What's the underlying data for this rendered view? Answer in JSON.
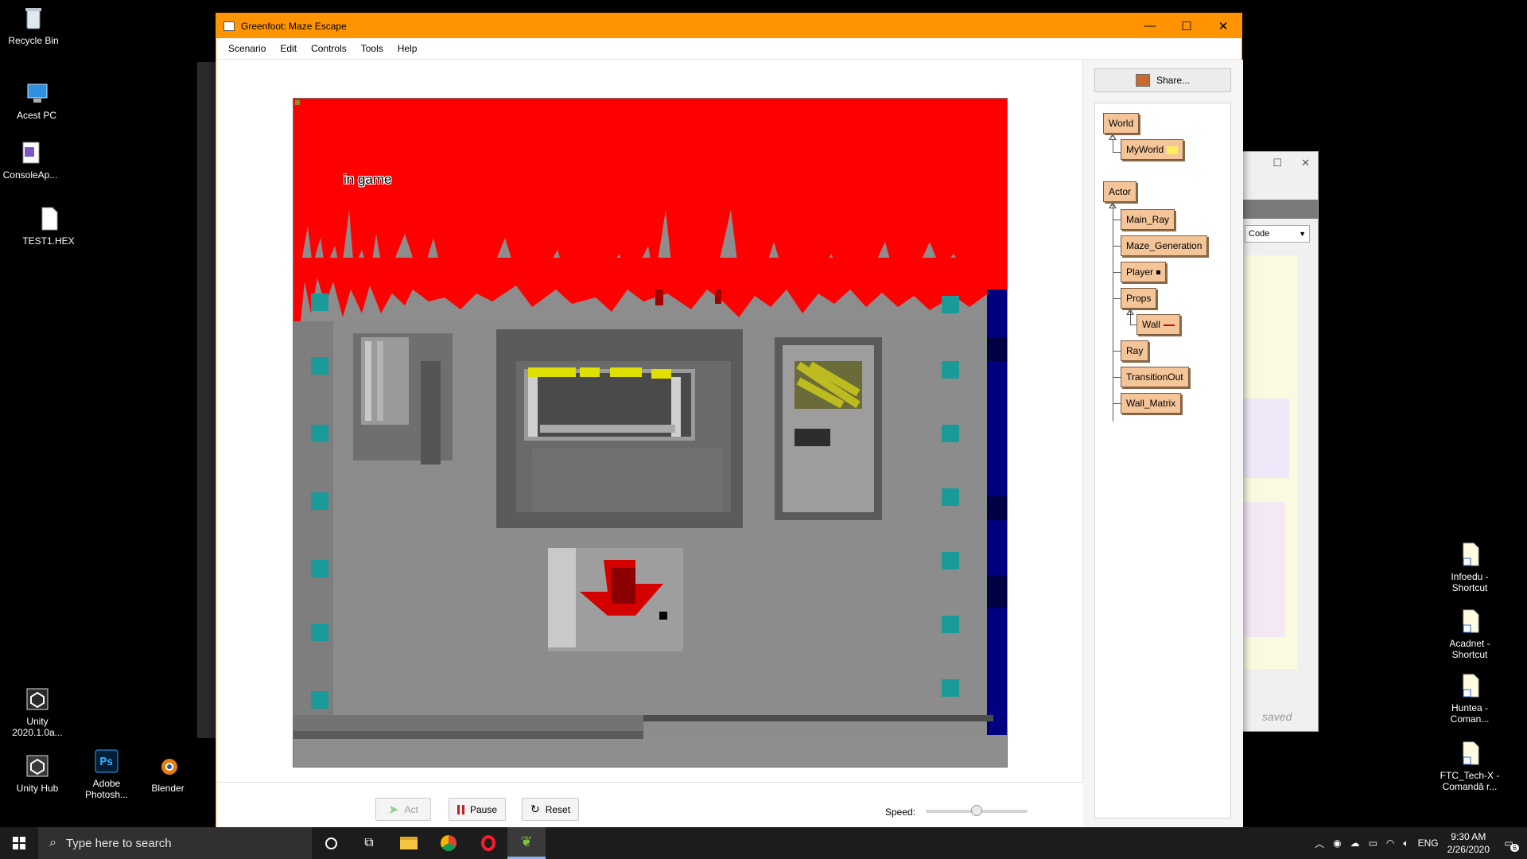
{
  "desktop": {
    "icons_left": [
      {
        "label": "Recycle Bin",
        "icon": "recycle-bin-icon"
      },
      {
        "label": "Acest PC",
        "icon": "this-pc-icon"
      },
      {
        "label": "ConsoleAp...",
        "icon": "console-app-icon"
      },
      {
        "label": "TEST1.HEX",
        "icon": "file-icon"
      }
    ],
    "icons_bottom": [
      {
        "label": "Unity 2020.1.0a...",
        "icon": "unity-icon"
      },
      {
        "label": "Unity Hub",
        "icon": "unity-hub-icon"
      },
      {
        "label": "Adobe Photosh...",
        "icon": "photoshop-icon"
      },
      {
        "label": "Blender",
        "icon": "blender-icon"
      }
    ],
    "icons_right": [
      {
        "label": "Infoedu - Shortcut",
        "icon": "shortcut-icon"
      },
      {
        "label": "Acadnet - Shortcut",
        "icon": "shortcut-icon"
      },
      {
        "label": "Huntea - Coman...",
        "icon": "shortcut-icon"
      },
      {
        "label": "FTC_Tech-X - Comandă r...",
        "icon": "shortcut-icon"
      }
    ]
  },
  "background_window": {
    "code_dropdown": "Code",
    "status": "saved"
  },
  "window": {
    "title": "Greenfoot: Maze Escape",
    "accent": "#ff9400",
    "menu": [
      "Scenario",
      "Edit",
      "Controls",
      "Tools",
      "Help"
    ],
    "world": {
      "overlay_text": "in game",
      "sky_color": "#ff0000"
    },
    "controls": {
      "act": "Act",
      "pause": "Pause",
      "reset": "Reset",
      "speed_label": "Speed:",
      "speed_fraction": 0.5
    },
    "class_panel": {
      "share": "Share...",
      "world_root": "World",
      "world_classes": [
        "MyWorld"
      ],
      "actor_root": "Actor",
      "actor_classes": [
        "Main_Ray",
        "Maze_Generation",
        "Player",
        "Props",
        "Ray",
        "TransitionOut",
        "Wall_Matrix"
      ],
      "props_subclasses": [
        "Wall"
      ]
    }
  },
  "taskbar": {
    "search_placeholder": "Type here to search",
    "tray": {
      "language": "ENG",
      "time": "9:30 AM",
      "date": "2/26/2020",
      "notifications": "6"
    }
  }
}
